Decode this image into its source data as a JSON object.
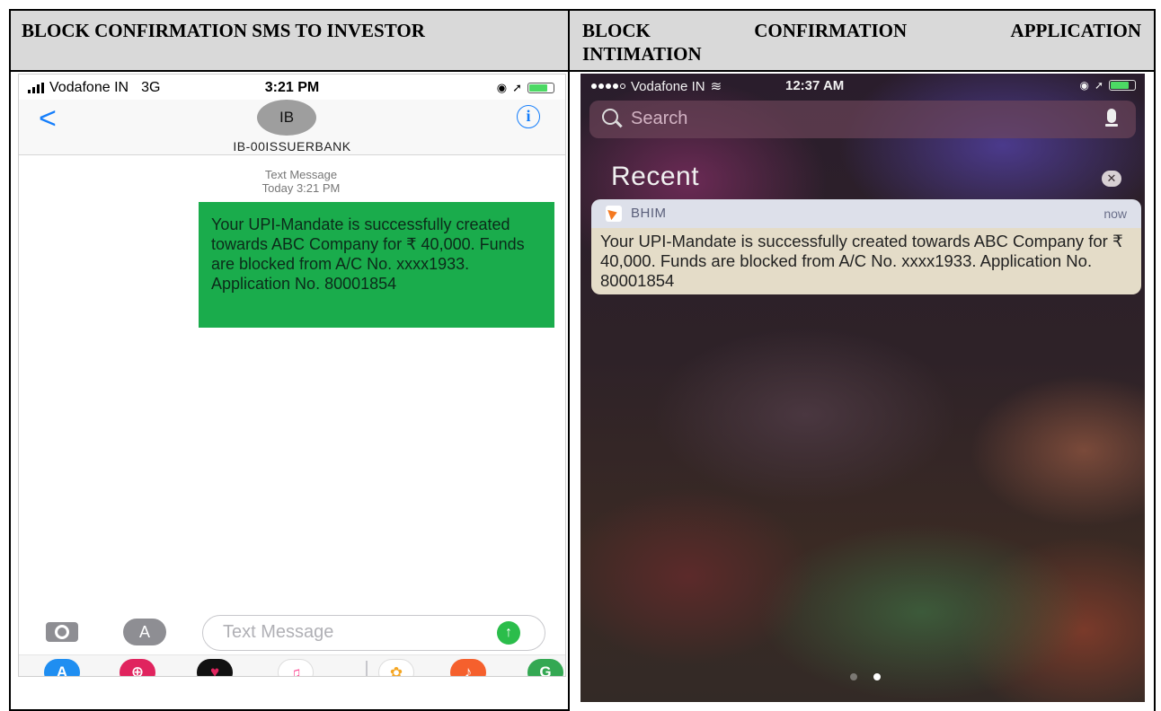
{
  "headers": {
    "left": "BLOCK CONFIRMATION SMS TO INVESTOR",
    "right_line1": [
      "BLOCK",
      "CONFIRMATION",
      "APPLICATION"
    ],
    "right_line2": "INTIMATION"
  },
  "sms_screen": {
    "status_bar": {
      "carrier": "Vodafone IN",
      "network": "3G",
      "time": "3:21 PM"
    },
    "contact_initials": "IB",
    "contact_name": "IB-00ISSUERBANK",
    "message_meta_type": "Text Message",
    "message_meta_time": "Today 3:21 PM",
    "message_text": "Your UPI-Mandate is successfully created towards ABC Company for ₹ 40,000. Funds are blocked from A/C No. xxxx1933. Application No. 80001854",
    "input_placeholder": "Text Message",
    "colors": {
      "bubble": "#1aac4c",
      "accent": "#157efb"
    },
    "tray_icons": [
      "app-store-icon",
      "web-search-icon",
      "heart-sticker-icon",
      "music-icon",
      "photos-icon",
      "garageband-icon",
      "maps-icon"
    ]
  },
  "notification_screen": {
    "status_bar": {
      "carrier": "Vodafone IN",
      "time": "12:37 AM"
    },
    "search_label": "Search",
    "section_title": "Recent",
    "notification": {
      "app_name": "BHIM",
      "time": "now",
      "body": "Your UPI-Mandate is successfully created towards ABC Company for ₹ 40,000. Funds are blocked from A/C No. xxxx1933. Application No. 80001854"
    }
  }
}
